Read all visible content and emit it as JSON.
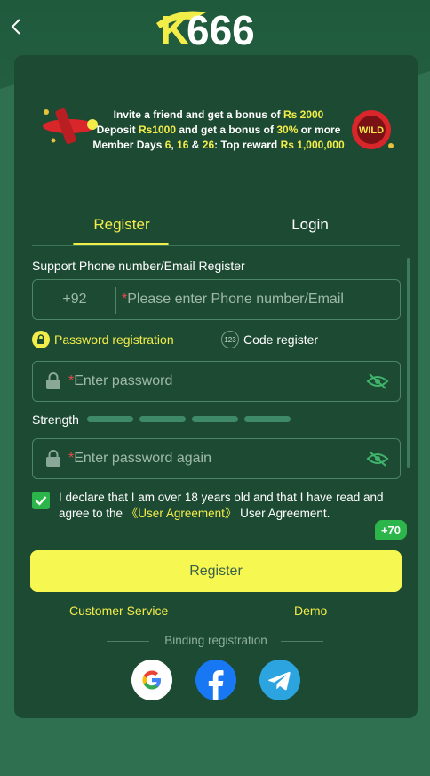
{
  "header": {
    "back_label": "<",
    "logo_text": "K666"
  },
  "banner": {
    "line1_pre": "Invite a friend and get a bonus of ",
    "line1_hl": "Rs 2000",
    "line2_pre": "Deposit ",
    "line2_hl1": "Rs1000",
    "line2_mid": " and get a bonus of ",
    "line2_hl2": "30%",
    "line2_post": " or more",
    "line3_pre": "Member Days ",
    "line3_hl1": "6",
    "line3_sep1": ", ",
    "line3_hl2": "16",
    "line3_sep2": " & ",
    "line3_hl3": "26",
    "line3_mid": ": Top reward ",
    "line3_hl4": "Rs 1,000,000",
    "wild_text": "WILD"
  },
  "tabs": [
    {
      "label": "Register",
      "active": true
    },
    {
      "label": "Login",
      "active": false
    }
  ],
  "form": {
    "section_label": "Support Phone number/Email Register",
    "phone_prefix": "+92",
    "required_mark": "*",
    "phone_placeholder": "Please enter Phone number/Email",
    "mode_password": "Password registration",
    "mode_code": "Code register",
    "mode_code_icon": "123",
    "password_placeholder": "Enter password",
    "strength_label": "Strength",
    "password_again_placeholder": "Enter password again",
    "agree_text_pre": "I declare that I am over 18 years old and that I have read and agree to the ",
    "agree_link": "《User Agreement》",
    "agree_text_post": " User Agreement.",
    "agree_checked": true,
    "bonus_badge": "+70",
    "register_button": "Register"
  },
  "links": {
    "customer_service": "Customer Service",
    "demo": "Demo"
  },
  "binding": {
    "label": "Binding registration",
    "providers": [
      "google-icon",
      "facebook-icon",
      "telegram-icon"
    ]
  },
  "colors": {
    "accent_yellow": "#f3ed4a",
    "card_bg": "#1d4a33",
    "page_bg": "#2e7050",
    "check_green": "#2cb54a"
  }
}
